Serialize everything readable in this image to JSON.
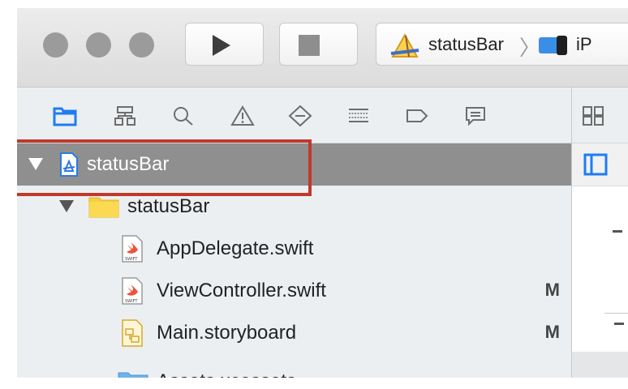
{
  "toolbar": {
    "run_label": "Run",
    "stop_label": "Stop",
    "scheme": {
      "project": "statusBar",
      "device_partial": "iP"
    }
  },
  "navigator_tabs": [
    "project-navigator",
    "symbol-navigator",
    "find-navigator",
    "issue-navigator",
    "test-navigator",
    "debug-navigator",
    "breakpoint-navigator",
    "report-navigator"
  ],
  "tree": {
    "project": {
      "label": "statusBar"
    },
    "group": {
      "label": "statusBar"
    },
    "files": [
      {
        "label": "AppDelegate.swift",
        "badge": ""
      },
      {
        "label": "ViewController.swift",
        "badge": "M"
      },
      {
        "label": "Main.storyboard",
        "badge": "M"
      }
    ],
    "partial_item": {
      "label": "Assets.xcassets"
    }
  },
  "colors": {
    "selected_row": "#8f8f8f",
    "highlight_border": "#c0392b",
    "accent_blue": "#1e7cf2",
    "folder_yellow": "#f8cf3c",
    "swift_orange": "#f05138"
  }
}
